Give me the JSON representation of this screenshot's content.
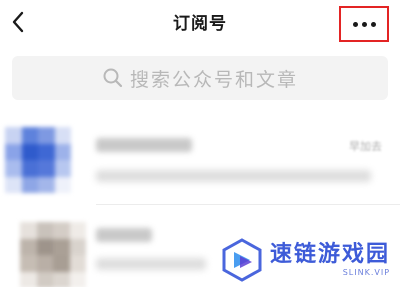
{
  "navbar": {
    "title": "订阅号",
    "back_icon": "chevron-left-icon",
    "more_icon": "more-horizontal-icon",
    "highlight_color": "#e32424"
  },
  "search": {
    "placeholder": "搜索公众号和文章",
    "icon": "search-icon"
  },
  "subscriptions": [
    {
      "name": "",
      "preview": "",
      "time": "早加去",
      "avatar_colors": [
        "#8aa3e8",
        "#3f68d4",
        "#5578da",
        "#a9bcee"
      ]
    },
    {
      "name": "",
      "preview": "",
      "time": "",
      "avatar_colors": [
        "#c9c2bb",
        "#9e948b",
        "#b9afa6",
        "#e2dcd6"
      ]
    }
  ],
  "watermark": {
    "text": "速链游戏园",
    "sub": "SLINK.VIP",
    "brand_color": "#3d5bd8"
  }
}
